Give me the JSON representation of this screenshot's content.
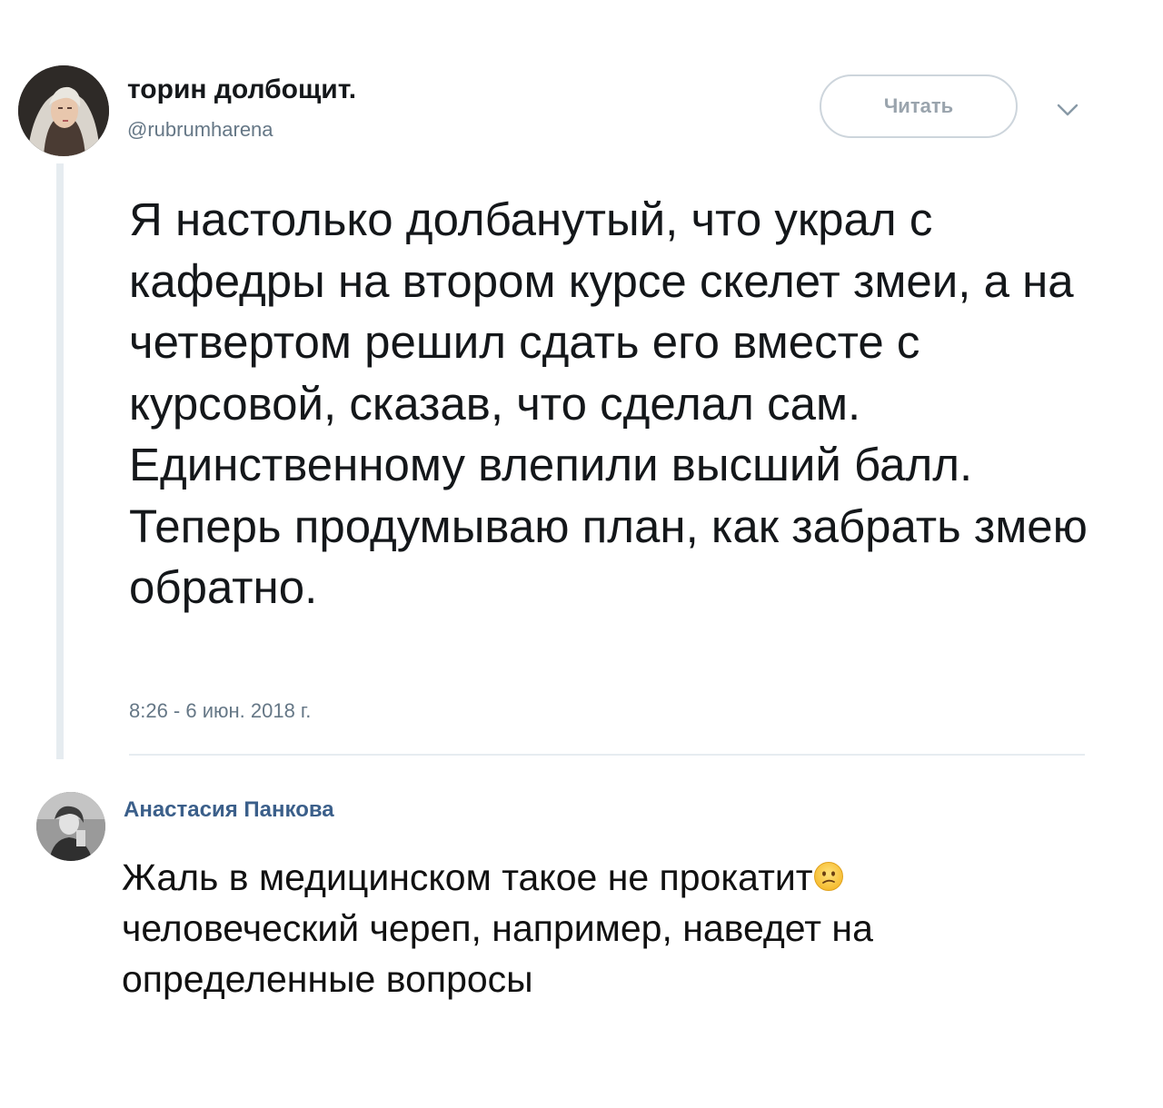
{
  "tweet": {
    "author_name": "торин долбощит.",
    "author_handle": "@rubrumharena",
    "follow_label": "Читать",
    "caret_icon": "chevron-down-icon",
    "text_paragraphs": [
      "Я настолько долбанутый, что украл с кафедры на втором курсе скелет змеи, а на четвертом решил сдать его вместе с курсовой, сказав, что сделал сам. Единственному влепили высший балл.",
      "Теперь продумываю план, как забрать змею обратно."
    ],
    "timestamp": "8:26 - 6 июн. 2018 г."
  },
  "comment": {
    "author_name": "Анастасия Панкова",
    "text_before_emoji": "Жаль в медицинском такое не прокатит",
    "emoji_icon": "confused-face-icon",
    "text_after_emoji": "человеческий череп, например, наведет на определенные вопросы"
  },
  "colors": {
    "name": "#14171a",
    "secondary": "#657786",
    "button_border": "#cdd5dc",
    "comment_author": "#3b5f8a",
    "divider": "#e6ecf0"
  }
}
